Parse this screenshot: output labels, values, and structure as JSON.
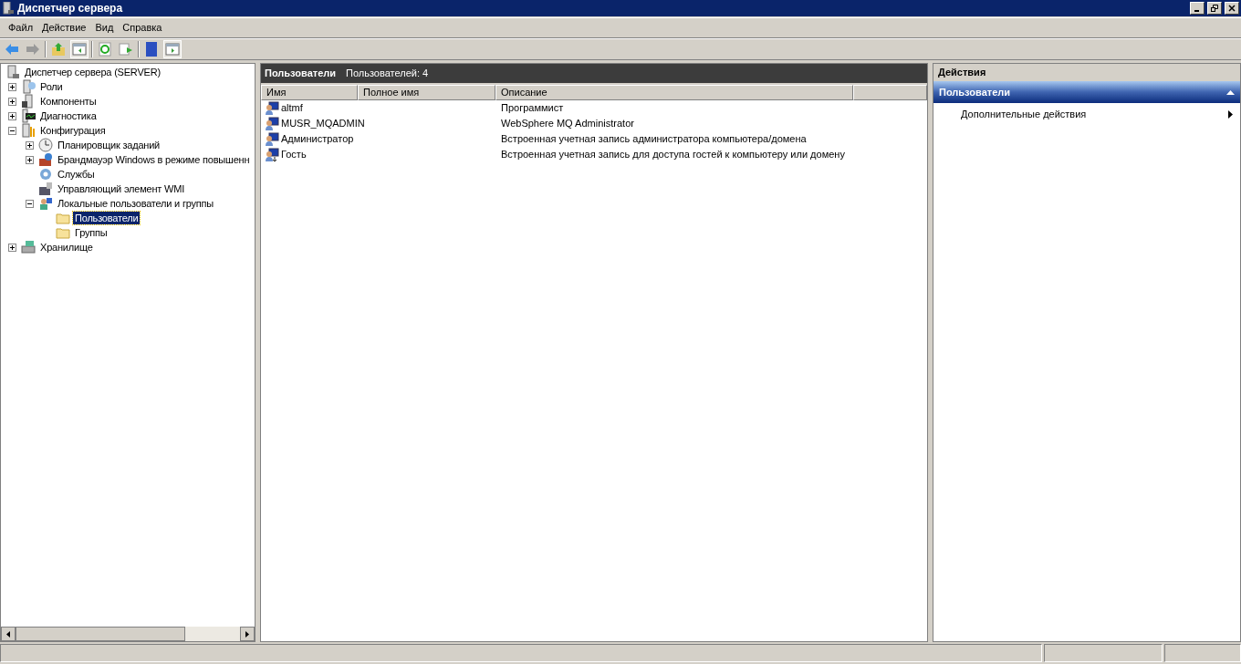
{
  "window": {
    "title": "Диспетчер сервера"
  },
  "menu": [
    "Файл",
    "Действие",
    "Вид",
    "Справка"
  ],
  "tree": [
    {
      "label": "Диспетчер сервера (SERVER)",
      "kind": "server",
      "selected": false,
      "children": [
        {
          "label": "Роли",
          "kind": "roles",
          "expanded": false,
          "selected": false
        },
        {
          "label": "Компоненты",
          "kind": "features",
          "expanded": false,
          "selected": false
        },
        {
          "label": "Диагностика",
          "kind": "diagnostics",
          "expanded": false,
          "selected": false
        },
        {
          "label": "Конфигурация",
          "kind": "config",
          "expanded": true,
          "selected": false,
          "children": [
            {
              "label": "Планировщик заданий",
              "kind": "clock",
              "expanded": false,
              "selected": false
            },
            {
              "label": "Брандмауэр Windows в режиме повышенн",
              "kind": "firewall",
              "expanded": false,
              "selected": false
            },
            {
              "label": "Службы",
              "kind": "services",
              "selected": false
            },
            {
              "label": "Управляющий элемент WMI",
              "kind": "wmi",
              "selected": false
            },
            {
              "label": "Локальные пользователи и группы",
              "kind": "users",
              "expanded": true,
              "selected": false,
              "children": [
                {
                  "label": "Пользователи",
                  "kind": "folder",
                  "selected": true
                },
                {
                  "label": "Группы",
                  "kind": "folder",
                  "selected": false
                }
              ]
            }
          ]
        },
        {
          "label": "Хранилище",
          "kind": "storage",
          "expanded": false,
          "selected": false
        }
      ]
    }
  ],
  "center": {
    "title": "Пользователи",
    "subtitle": "Пользователей: 4",
    "columns": [
      "Имя",
      "Полное имя",
      "Описание"
    ],
    "rows": [
      {
        "name": "altmf",
        "description": "Программист",
        "kind": "user"
      },
      {
        "name": "MUSR_MQADMIN",
        "description": "WebSphere MQ Administrator",
        "kind": "user"
      },
      {
        "name": "Администратор",
        "description": "Встроенная учетная запись администратора компьютера/домена",
        "kind": "user"
      },
      {
        "name": "Гость",
        "description": "Встроенная учетная запись для доступа гостей к компьютеру или домену",
        "kind": "guest"
      }
    ]
  },
  "actions": {
    "title": "Действия",
    "section": "Пользователи",
    "items": [
      "Дополнительные действия"
    ]
  }
}
